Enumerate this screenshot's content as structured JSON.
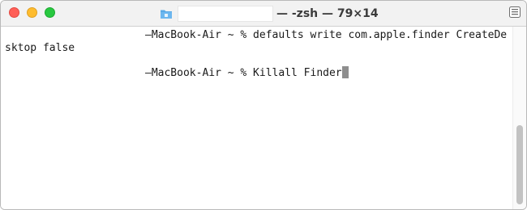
{
  "window": {
    "title": "— -zsh — 79×14"
  },
  "terminal": {
    "line1": "—MacBook-Air ~ % defaults write com.apple.finder CreateDe",
    "line2": "sktop false",
    "line3": "—MacBook-Air ~ % Killall Finder"
  },
  "colors": {
    "close": "#ff5f57",
    "minimize": "#febc2e",
    "zoom": "#28c840",
    "folder_icon": "#5aa9e6",
    "cursor": "#8e8e8e"
  },
  "icons": {
    "title_icon": "folder-icon",
    "sidebar_toggle": "sidebar-toggle-icon"
  },
  "scroll": {
    "visible_fraction": 0.43,
    "position_fraction": 1.0
  }
}
